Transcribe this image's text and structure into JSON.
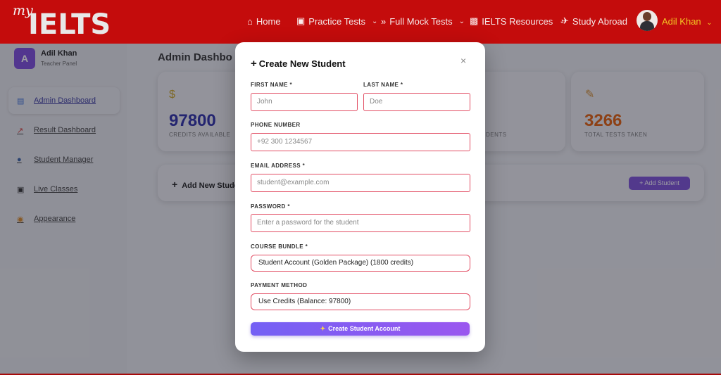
{
  "brand": {
    "prefix": "my",
    "name": "IELTS"
  },
  "nav": {
    "home": "Home",
    "practice_tests": "Practice Tests",
    "full_mock_tests": "Full Mock Tests",
    "ielts_resources": "IELTS Resources",
    "study_abroad": "Study Abroad",
    "user": "Adil Khan"
  },
  "sidebar": {
    "avatar_letter": "A",
    "name": "Adil Khan",
    "role": "Teacher Panel",
    "items": [
      {
        "label": "Admin Dashboard",
        "icon": "bar-chart-icon"
      },
      {
        "label": "Result Dashboard",
        "icon": "trend-chart-icon"
      },
      {
        "label": "Student Manager",
        "icon": "users-icon"
      },
      {
        "label": "Live Classes",
        "icon": "video-camera-icon"
      },
      {
        "label": "Appearance",
        "icon": "palette-icon"
      }
    ]
  },
  "main": {
    "title": "Admin Dashbo",
    "stats": [
      {
        "value": "97800",
        "label": "CREDITS AVAILABLE",
        "color": "#2d2fa8"
      },
      {
        "value": "",
        "label": "DENTS"
      },
      {
        "value": "3266",
        "label": "TOTAL TESTS TAKEN",
        "color": "#e2600d"
      }
    ],
    "add_section_label": "Add New Stude",
    "add_button": "+ Add Student"
  },
  "modal": {
    "title": "Create New Student",
    "close": "×",
    "fields": {
      "first_name": {
        "label": "FIRST NAME *",
        "placeholder": "John"
      },
      "last_name": {
        "label": "LAST NAME *",
        "placeholder": "Doe"
      },
      "phone": {
        "label": "PHONE NUMBER",
        "placeholder": "+92 300 1234567"
      },
      "email": {
        "label": "EMAIL ADDRESS *",
        "placeholder": "student@example.com"
      },
      "password": {
        "label": "PASSWORD *",
        "placeholder": "Enter a password for the student"
      },
      "course_bundle": {
        "label": "COURSE BUNDLE *",
        "value": "Student Account (Golden Package) (1800 credits)"
      },
      "payment_method": {
        "label": "PAYMENT METHOD",
        "value": "Use Credits (Balance: 97800)"
      }
    },
    "submit": "Create Student Account"
  },
  "colors": {
    "header": "#c40c0c",
    "accent": "#7d52d8",
    "input_border": "#e24d63"
  }
}
